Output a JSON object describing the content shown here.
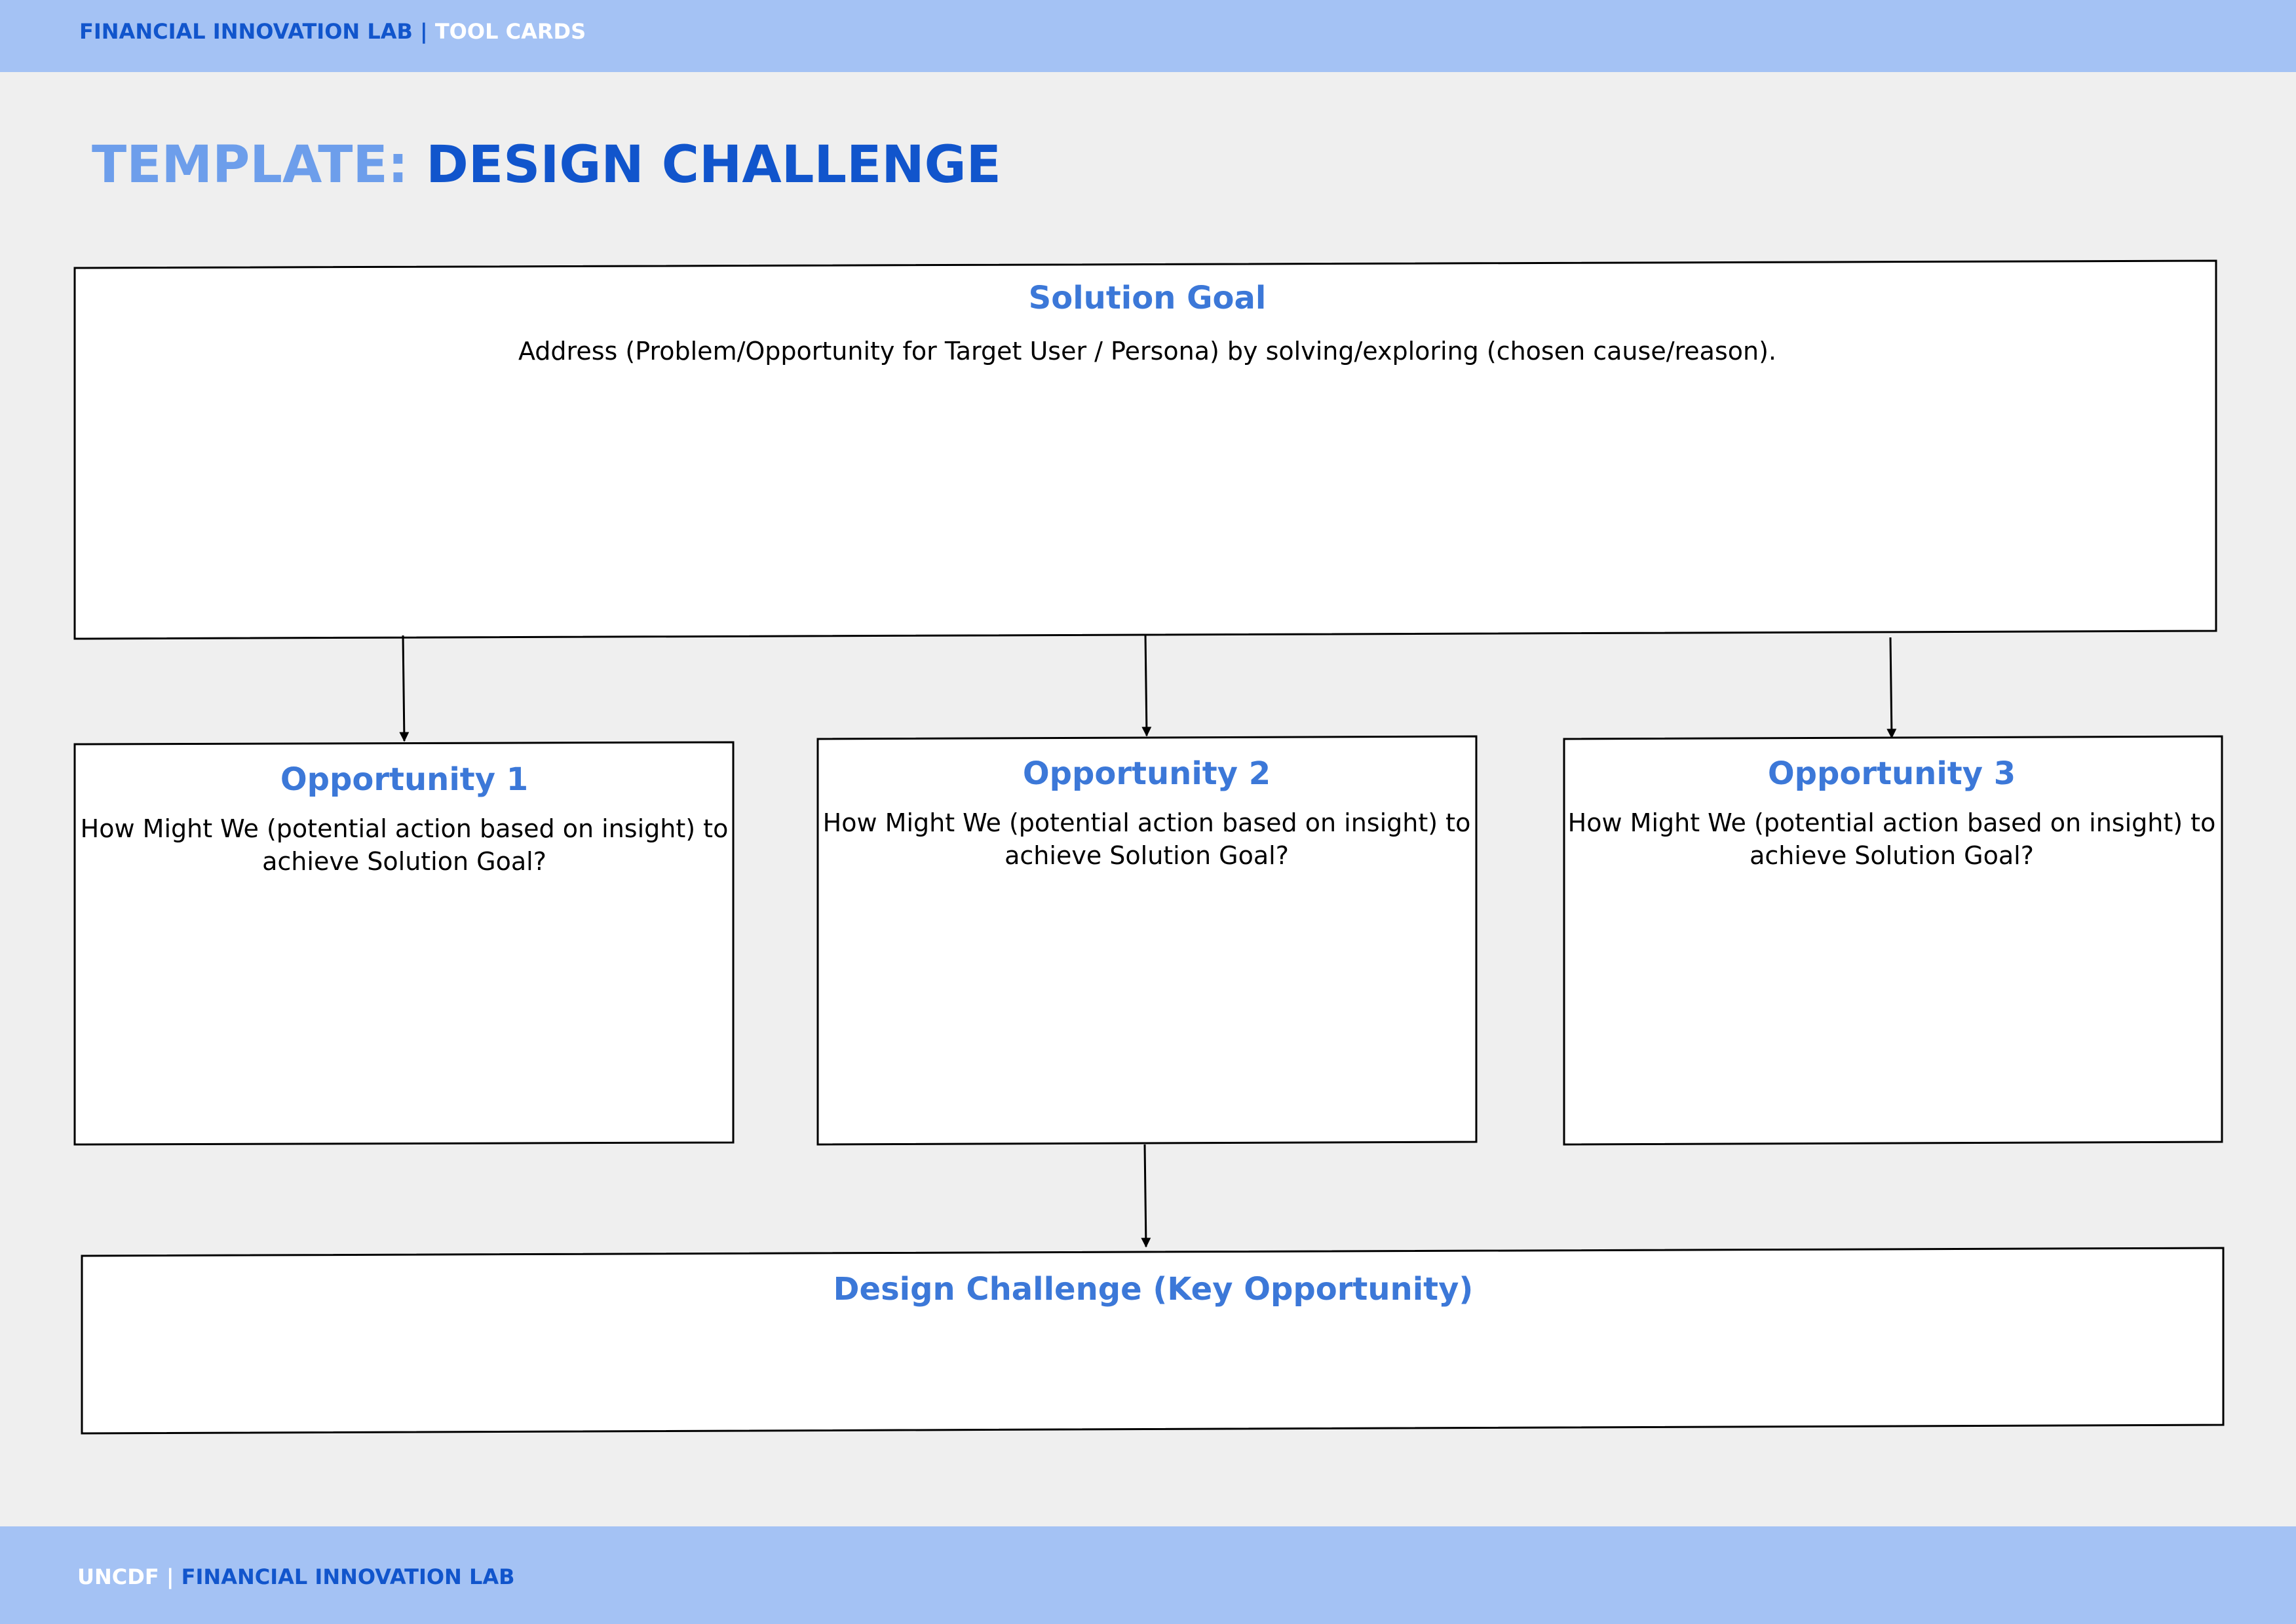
{
  "header": {
    "org": "FINANCIAL INNOVATION LAB",
    "separator": "|",
    "section": "TOOL CARDS"
  },
  "title": {
    "prefix": "TEMPLATE:",
    "main": "DESIGN CHALLENGE"
  },
  "solution_goal": {
    "heading": "Solution Goal",
    "body": "Address (Problem/Opportunity for Target User / Persona) by solving/exploring (chosen cause/reason)."
  },
  "opportunities": [
    {
      "heading": "Opportunity 1",
      "body": "How Might We (potential action based on insight) to achieve Solution Goal?"
    },
    {
      "heading": "Opportunity 2",
      "body": "How Might We (potential action based on insight) to achieve Solution Goal?"
    },
    {
      "heading": "Opportunity 3",
      "body": "How Might We (potential action based on insight) to achieve Solution Goal?"
    }
  ],
  "design_challenge": {
    "heading": "Design Challenge (Key Opportunity)"
  },
  "footer": {
    "org": "UNCDF",
    "separator": "|",
    "lab": "FINANCIAL INNOVATION LAB"
  },
  "colors": {
    "band": "#a4c2f4",
    "background": "#efefef",
    "dark_blue": "#1155cc",
    "heading_blue": "#3c78d8",
    "title_prefix_blue": "#6d9eeb"
  }
}
